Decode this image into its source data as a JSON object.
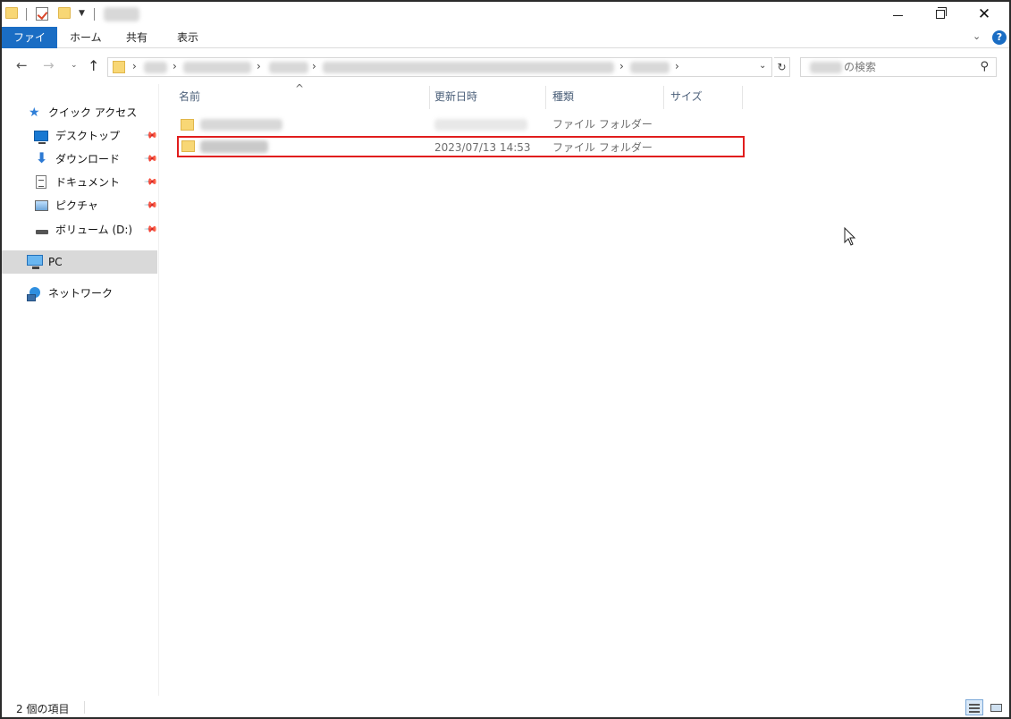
{
  "ribbon": {
    "tabs": [
      {
        "label": "ファイル"
      },
      {
        "label": "ホーム"
      },
      {
        "label": "共有"
      },
      {
        "label": "表示"
      }
    ],
    "help": "?"
  },
  "search": {
    "placeholder": "の検索"
  },
  "navpane": {
    "quick_access": "クイック アクセス",
    "items": [
      {
        "label": "デスクトップ"
      },
      {
        "label": "ダウンロード"
      },
      {
        "label": "ドキュメント"
      },
      {
        "label": "ピクチャ"
      },
      {
        "label": "ボリューム (D:)"
      }
    ],
    "pc": "PC",
    "network": "ネットワーク"
  },
  "columns": {
    "name": "名前",
    "date": "更新日時",
    "type": "種類",
    "size": "サイズ"
  },
  "rows": [
    {
      "date": "",
      "type": "ファイル フォルダー"
    },
    {
      "date": "2023/07/13 14:53",
      "type": "ファイル フォルダー"
    }
  ],
  "status": {
    "count": "2 個の項目"
  },
  "colors": {
    "accent": "#1a6dc4",
    "highlight_border": "#e11d1d",
    "folder": "#f8d775",
    "selected_nav": "#d9d9d9"
  }
}
